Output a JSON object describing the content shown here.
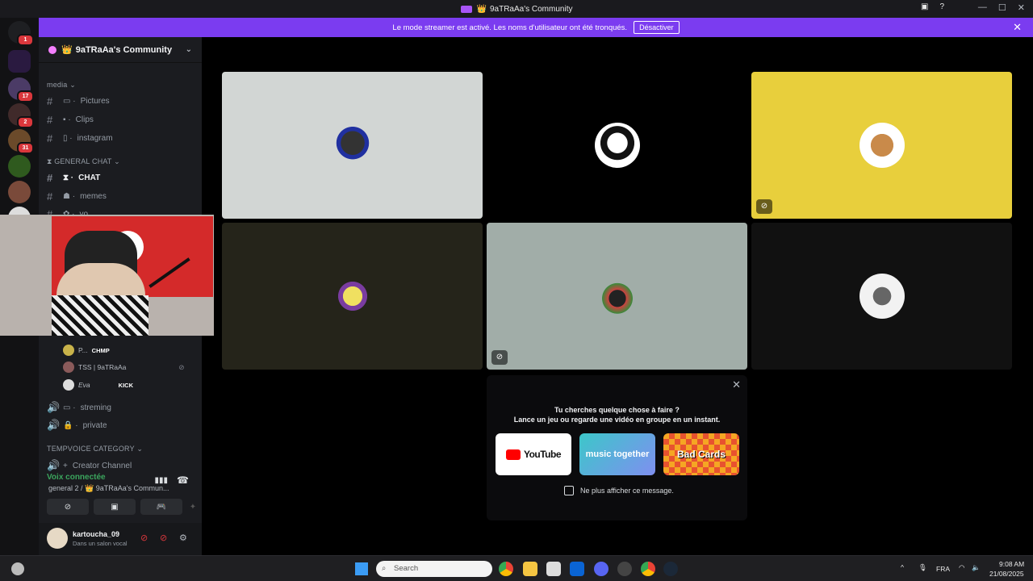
{
  "window": {
    "title": "9aTRaAa's Community"
  },
  "banner": {
    "text": "Le mode streamer est activé. Les noms d'utilisateur ont été tronqués.",
    "button": "Désactiver"
  },
  "server": {
    "name": "9aTRaAa's Community"
  },
  "server_badges": [
    "1",
    "17",
    "2",
    "31"
  ],
  "channels": {
    "media_category": "media",
    "media": [
      "Pictures",
      "Clips",
      "instagram"
    ],
    "general_category": "GENERAL CHAT",
    "general": [
      "CHAT",
      "memes",
      "yo"
    ],
    "voice": [
      "streming",
      "private"
    ],
    "tempvoice_category": "TEMPVOICE CATEGORY",
    "tempvoice": [
      "Creator Channel"
    ]
  },
  "members": [
    {
      "name": "P...",
      "tag": "CHMP"
    },
    {
      "name": "TSS | 9aTRaAa",
      "tag": ""
    },
    {
      "name": "Eva",
      "tag": "KICK"
    }
  ],
  "voice_panel": {
    "status": "Voix connectée",
    "channel": "general 2 / 👑 9aTRaAa's Commun..."
  },
  "user": {
    "name": "kartoucha_09",
    "status": "Dans un salon vocal"
  },
  "activity_popup": {
    "title": "Tu cherches quelque chose à faire ?",
    "subtitle": "Lance un jeu ou regarde une vidéo en groupe en un instant.",
    "activities": [
      "YouTube",
      "music together",
      "Bad Cards"
    ],
    "checkbox_label": "Ne plus afficher ce message."
  },
  "taskbar": {
    "search_placeholder": "Search",
    "lang": "FRA",
    "time": "9:08 AM",
    "date": "21/08/2025"
  },
  "colors": {
    "banner": "#7b3cf0",
    "yellow_tile": "#e8cf3c",
    "olive_tile": "#25241a",
    "grey_tile": "#d2d6d4",
    "teal_tile": "#a1ada8"
  }
}
